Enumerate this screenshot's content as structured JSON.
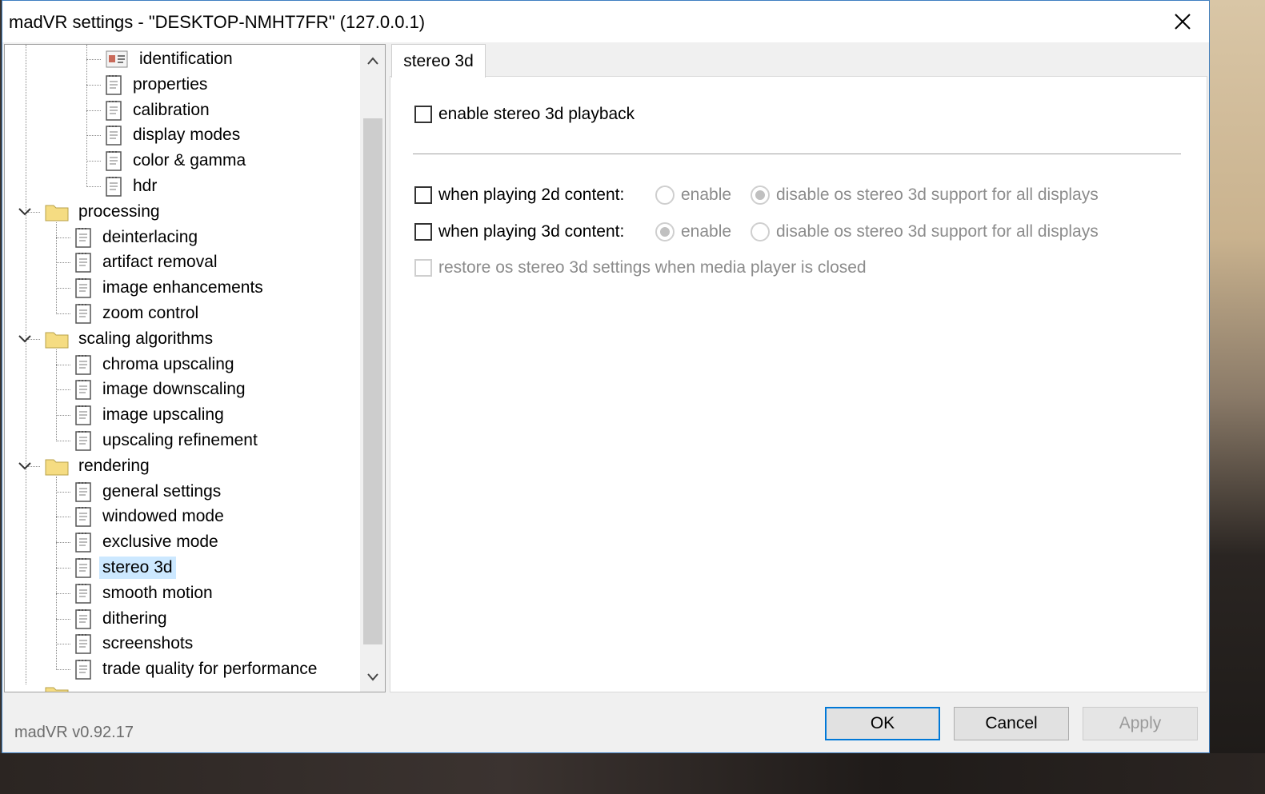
{
  "window": {
    "title": "madVR settings - \"DESKTOP-NMHT7FR\" (127.0.0.1)"
  },
  "tree": {
    "items": [
      {
        "label": "identification",
        "kind": "doc-special",
        "level": 2
      },
      {
        "label": "properties",
        "kind": "doc",
        "level": 2
      },
      {
        "label": "calibration",
        "kind": "doc",
        "level": 2
      },
      {
        "label": "display modes",
        "kind": "doc",
        "level": 2
      },
      {
        "label": "color & gamma",
        "kind": "doc",
        "level": 2
      },
      {
        "label": "hdr",
        "kind": "doc",
        "level": 2
      },
      {
        "label": "processing",
        "kind": "folder",
        "level": 0,
        "expanded": true
      },
      {
        "label": "deinterlacing",
        "kind": "doc",
        "level": 1
      },
      {
        "label": "artifact removal",
        "kind": "doc",
        "level": 1
      },
      {
        "label": "image enhancements",
        "kind": "doc",
        "level": 1
      },
      {
        "label": "zoom control",
        "kind": "doc",
        "level": 1
      },
      {
        "label": "scaling algorithms",
        "kind": "folder",
        "level": 0,
        "expanded": true
      },
      {
        "label": "chroma upscaling",
        "kind": "doc",
        "level": 1
      },
      {
        "label": "image downscaling",
        "kind": "doc",
        "level": 1
      },
      {
        "label": "image upscaling",
        "kind": "doc",
        "level": 1
      },
      {
        "label": "upscaling refinement",
        "kind": "doc",
        "level": 1
      },
      {
        "label": "rendering",
        "kind": "folder",
        "level": 0,
        "expanded": true
      },
      {
        "label": "general settings",
        "kind": "doc",
        "level": 1
      },
      {
        "label": "windowed mode",
        "kind": "doc",
        "level": 1
      },
      {
        "label": "exclusive mode",
        "kind": "doc",
        "level": 1
      },
      {
        "label": "stereo 3d",
        "kind": "doc",
        "level": 1,
        "selected": true
      },
      {
        "label": "smooth motion",
        "kind": "doc",
        "level": 1
      },
      {
        "label": "dithering",
        "kind": "doc",
        "level": 1
      },
      {
        "label": "screenshots",
        "kind": "doc",
        "level": 1
      },
      {
        "label": "trade quality for performance",
        "kind": "doc",
        "level": 1
      }
    ]
  },
  "tab": {
    "label": "stereo 3d"
  },
  "settings": {
    "enable_label": "enable stereo 3d playback",
    "row2d": {
      "label": "when playing 2d content:",
      "enable_label": "enable",
      "disable_label": "disable os stereo 3d support for all displays",
      "selected": "disable"
    },
    "row3d": {
      "label": "when playing 3d content:",
      "enable_label": "enable",
      "disable_label": "disable os stereo 3d support for all displays",
      "selected": "enable"
    },
    "restore_label": "restore os stereo 3d settings when media player is closed"
  },
  "footer": {
    "version": "madVR v0.92.17",
    "ok_label": "OK",
    "cancel_label": "Cancel",
    "apply_label": "Apply"
  },
  "colors": {
    "accent": "#0078d7",
    "selection": "#cce8ff",
    "folder": "#f5dc82"
  }
}
